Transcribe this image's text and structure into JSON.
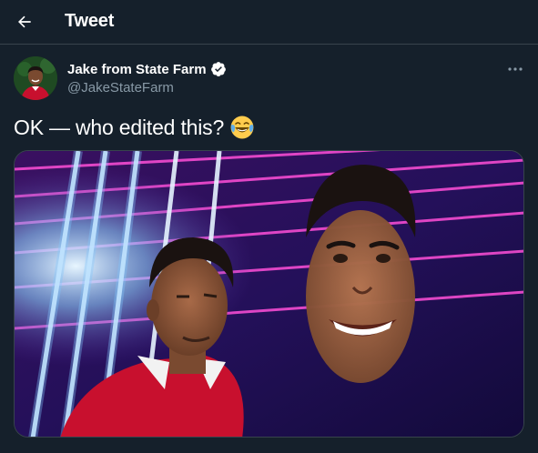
{
  "header": {
    "title": "Tweet"
  },
  "tweet": {
    "author": {
      "display_name": "Jake from State Farm",
      "handle": "@JakeStateFarm",
      "verified": true
    },
    "text": "OK — who edited this?",
    "emoji": "face-with-tears-of-joy",
    "media": {
      "type": "image"
    }
  },
  "colors": {
    "background": "#15202b",
    "divider": "#38444d",
    "secondary_text": "#8899a6",
    "verified_badge": "#ffffff"
  }
}
